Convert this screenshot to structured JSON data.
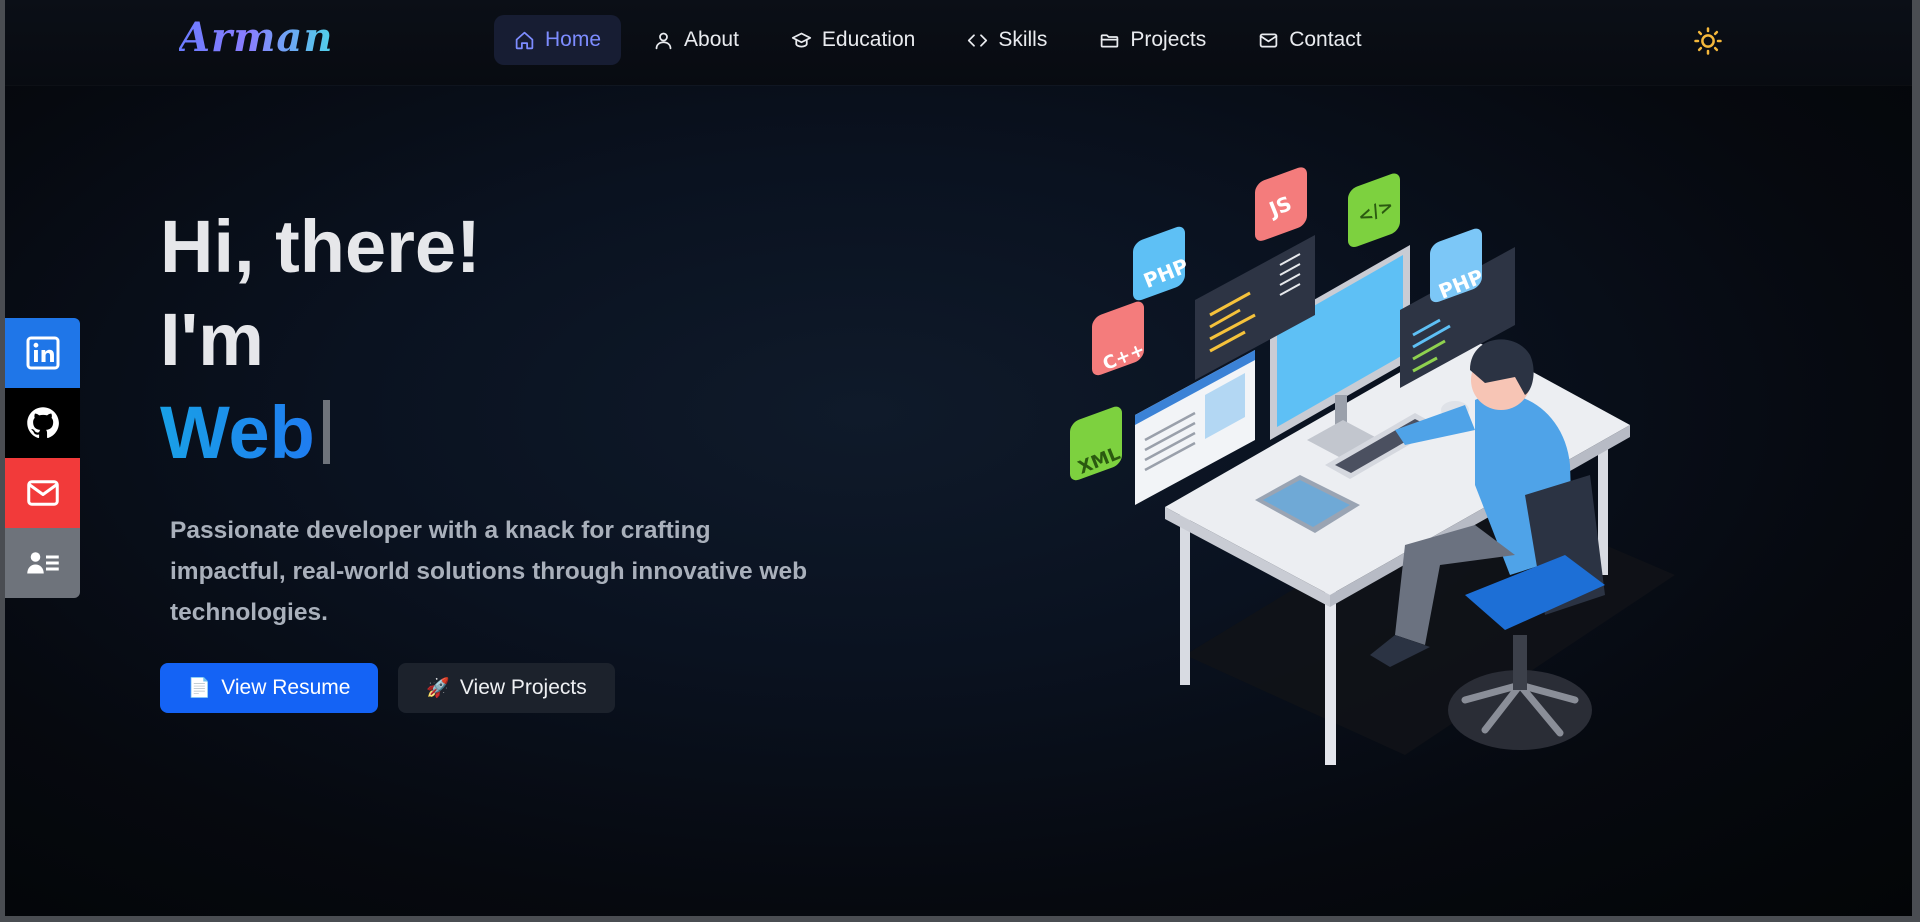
{
  "brand": {
    "logo_text": "Arman"
  },
  "nav": {
    "items": [
      {
        "label": "Home",
        "icon": "home-icon",
        "active": true
      },
      {
        "label": "About",
        "icon": "user-icon",
        "active": false
      },
      {
        "label": "Education",
        "icon": "graduation-cap-icon",
        "active": false
      },
      {
        "label": "Skills",
        "icon": "code-icon",
        "active": false
      },
      {
        "label": "Projects",
        "icon": "folder-icon",
        "active": false
      },
      {
        "label": "Contact",
        "icon": "mail-icon",
        "active": false
      }
    ],
    "theme_toggle_icon": "sun-icon"
  },
  "social": {
    "items": [
      {
        "name": "linkedin",
        "icon": "linkedin-icon",
        "color": "#1f76e8"
      },
      {
        "name": "github",
        "icon": "github-icon",
        "color": "#000000"
      },
      {
        "name": "email",
        "icon": "mail-icon",
        "color": "#f23a3a"
      },
      {
        "name": "resume",
        "icon": "contact-card-icon",
        "color": "#6e737b"
      }
    ]
  },
  "hero": {
    "line1": "Hi, there!",
    "line2": "I'm",
    "typed_text": "Web",
    "description": "Passionate developer with a knack for crafting impactful, real-world solutions through innovative web technologies.",
    "primary_button": {
      "emoji": "📄",
      "label": "View Resume"
    },
    "secondary_button": {
      "emoji": "🚀",
      "label": "View Projects"
    }
  },
  "illustration": {
    "badges": [
      "PHP",
      "JS",
      "</>",
      "PHP",
      "C++",
      "XML"
    ]
  },
  "colors": {
    "accent": "#1463f5",
    "nav_active": "#7d8cff",
    "sun": "#f5b83b"
  }
}
